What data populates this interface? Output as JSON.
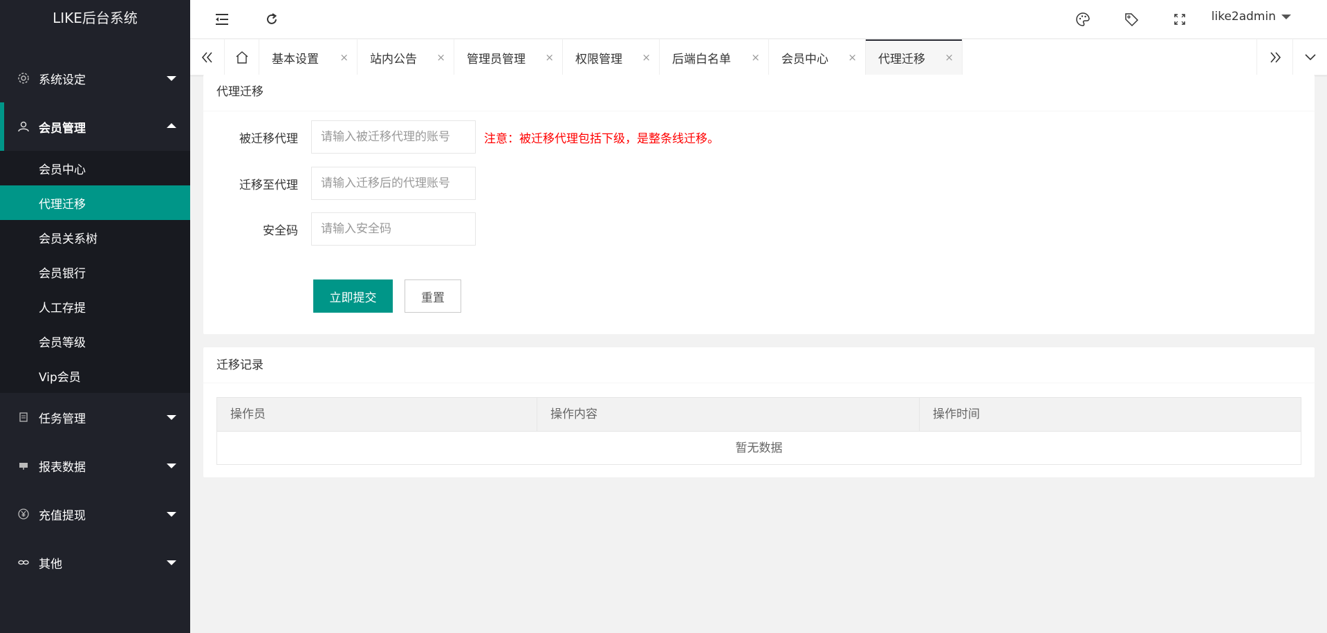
{
  "app": {
    "title": "LIKE后台系统"
  },
  "sidebar": {
    "groups": [
      {
        "label": "系统设定",
        "icon": "gear-icon",
        "expanded": false
      },
      {
        "label": "会员管理",
        "icon": "user-icon",
        "expanded": true
      },
      {
        "label": "任务管理",
        "icon": "document-icon",
        "expanded": false
      },
      {
        "label": "报表数据",
        "icon": "chart-icon",
        "expanded": false
      },
      {
        "label": "充值提现",
        "icon": "yen-icon",
        "expanded": false
      },
      {
        "label": "其他",
        "icon": "link-icon",
        "expanded": false
      }
    ],
    "member_submenu": [
      {
        "label": "会员中心"
      },
      {
        "label": "代理迁移",
        "current": true
      },
      {
        "label": "会员关系树"
      },
      {
        "label": "会员银行"
      },
      {
        "label": "人工存提"
      },
      {
        "label": "会员等级"
      },
      {
        "label": "Vip会员"
      }
    ]
  },
  "header": {
    "user": "like2admin"
  },
  "tabs": [
    {
      "label": "基本设置"
    },
    {
      "label": "站内公告"
    },
    {
      "label": "管理员管理"
    },
    {
      "label": "权限管理"
    },
    {
      "label": "后端白名单"
    },
    {
      "label": "会员中心"
    },
    {
      "label": "代理迁移",
      "active": true
    }
  ],
  "tab_close": "×",
  "migrate_form": {
    "title": "代理迁移",
    "source_label": "被迁移代理",
    "source_placeholder": "请输入被迁移代理的账号",
    "note": "注意：被迁移代理包括下级，是整条线迁移。",
    "target_label": "迁移至代理",
    "target_placeholder": "请输入迁移后的代理账号",
    "code_label": "安全码",
    "code_placeholder": "请输入安全码",
    "submit_label": "立即提交",
    "reset_label": "重置"
  },
  "records": {
    "title": "迁移记录",
    "columns": [
      "操作员",
      "操作内容",
      "操作时间"
    ],
    "empty_text": "暂无数据"
  },
  "colors": {
    "accent": "#009688",
    "sidebar_bg": "#20222a",
    "note": "#ff0000"
  }
}
